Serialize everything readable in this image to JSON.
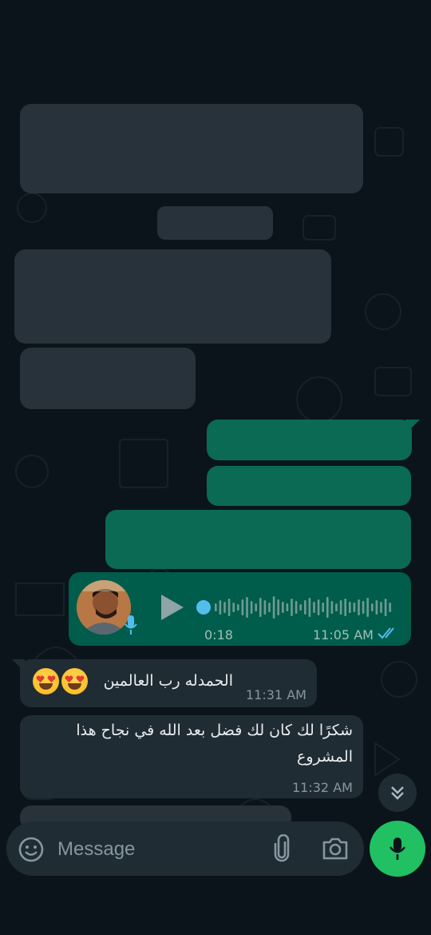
{
  "colors": {
    "background": "#0b141a",
    "incoming_bubble": "#202c33",
    "outgoing_bubble": "#005c4b",
    "accent_green": "#21c063",
    "read_ticks": "#53bdeb",
    "secondary_text": "#8696a0"
  },
  "voice_message": {
    "duration": "0:18",
    "time": "11:05 AM",
    "status_icon": "double-check-read-icon"
  },
  "messages": [
    {
      "text": "الحمدله رب العالمين",
      "time": "11:31 AM"
    },
    {
      "text": "شكرًا لك كان لك فضل بعد الله في نجاح هذا المشروع",
      "time": "11:32 AM"
    }
  ],
  "composer": {
    "placeholder": "Message",
    "icons": [
      "emoji-icon",
      "attach-icon",
      "camera-icon",
      "mic-icon"
    ]
  },
  "scroll_button_icon": "chevrons-down-icon"
}
